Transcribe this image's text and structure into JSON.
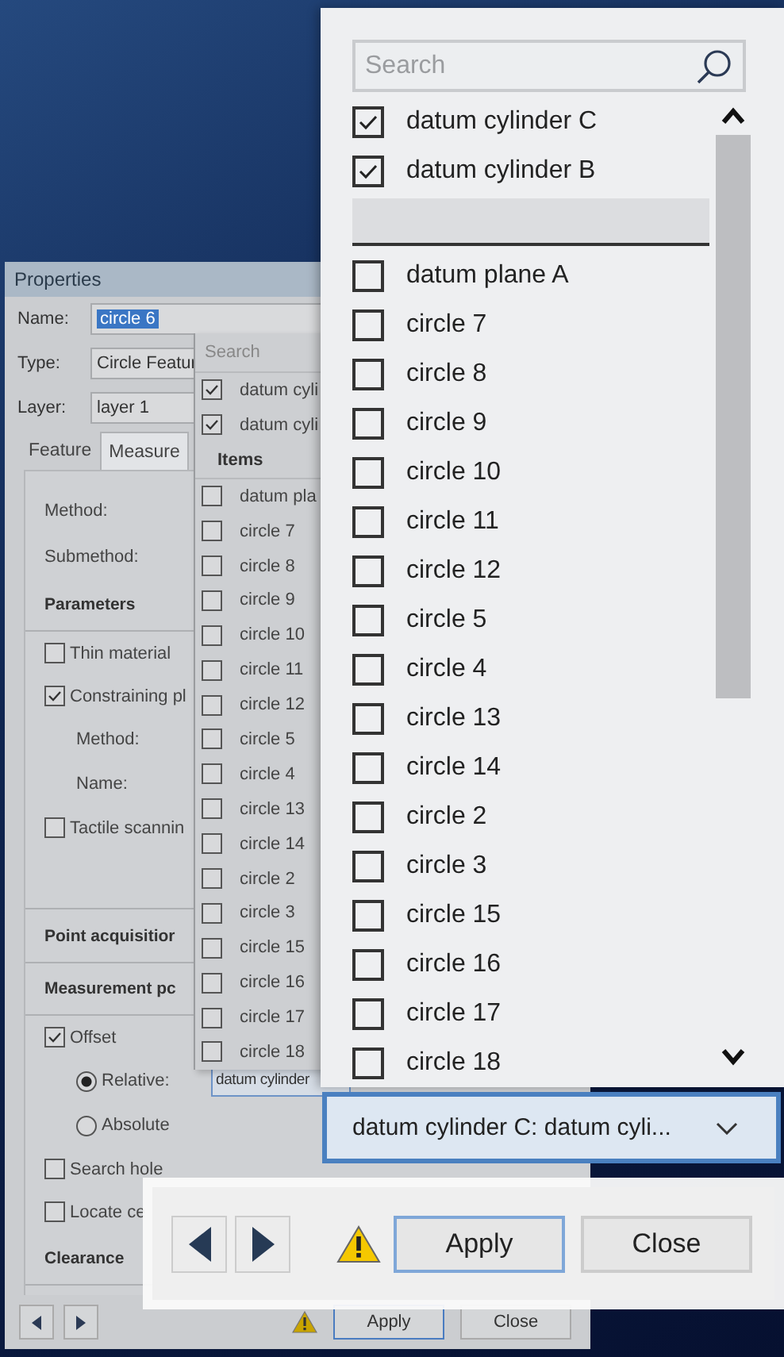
{
  "properties_window": {
    "title": "Properties",
    "fields": [
      {
        "label": "Name:",
        "value": "circle 6",
        "selected": true
      },
      {
        "label": "Type:",
        "value": "Circle Featur",
        "selected": false
      },
      {
        "label": "Layer:",
        "value": "layer 1",
        "selected": false
      }
    ],
    "tabs": [
      {
        "label": "Feature",
        "selected": false
      },
      {
        "label": "Measure",
        "selected": true
      }
    ],
    "rows": [
      {
        "kind": "label",
        "label": "Method:"
      },
      {
        "kind": "label",
        "label": "Submethod:"
      },
      {
        "kind": "heading",
        "label": "Parameters"
      },
      {
        "kind": "checkbox",
        "label": "Thin material",
        "checked": false
      },
      {
        "kind": "checkbox",
        "label": "Constraining pl",
        "checked": true
      },
      {
        "kind": "sublabel",
        "label": "Method:"
      },
      {
        "kind": "sublabel",
        "label": "Name:"
      },
      {
        "kind": "checkbox",
        "label": "Tactile scannin",
        "checked": false
      },
      {
        "kind": "section",
        "label": "Point acquisitior"
      },
      {
        "kind": "heading",
        "label": "Measurement pc"
      },
      {
        "kind": "checkbox",
        "label": "Offset",
        "checked": true
      },
      {
        "kind": "radio",
        "label": "Relative:",
        "selected": true,
        "value": "datum cylinder"
      },
      {
        "kind": "radio",
        "label": "Absolute",
        "selected": false
      },
      {
        "kind": "checkbox",
        "label": "Search hole",
        "checked": false
      },
      {
        "kind": "checkbox",
        "label": "Locate ce",
        "checked": false
      },
      {
        "kind": "heading",
        "label": "Clearance"
      }
    ],
    "dropdown": {
      "search_placeholder": "Search",
      "pinned": [
        {
          "label": "datum cyli",
          "checked": true
        },
        {
          "label": "datum cyli",
          "checked": true
        }
      ],
      "header": "Items",
      "items": [
        {
          "label": "datum pla",
          "checked": false
        },
        {
          "label": "circle 7",
          "checked": false
        },
        {
          "label": "circle 8",
          "checked": false
        },
        {
          "label": "circle 9",
          "checked": false
        },
        {
          "label": "circle 10",
          "checked": false
        },
        {
          "label": "circle 11",
          "checked": false
        },
        {
          "label": "circle 12",
          "checked": false
        },
        {
          "label": "circle 5",
          "checked": false
        },
        {
          "label": "circle 4",
          "checked": false
        },
        {
          "label": "circle 13",
          "checked": false
        },
        {
          "label": "circle 14",
          "checked": false
        },
        {
          "label": "circle 2",
          "checked": false
        },
        {
          "label": "circle 3",
          "checked": false
        },
        {
          "label": "circle 15",
          "checked": false
        },
        {
          "label": "circle 16",
          "checked": false
        },
        {
          "label": "circle 17",
          "checked": false
        },
        {
          "label": "circle 18",
          "checked": false
        }
      ]
    },
    "buttons": {
      "apply": "Apply",
      "close": "Close"
    }
  },
  "zoom_list": {
    "search_placeholder": "Search",
    "pinned": [
      {
        "label": "datum cylinder C",
        "checked": true
      },
      {
        "label": "datum cylinder B",
        "checked": true
      }
    ],
    "items": [
      {
        "label": "datum plane A",
        "checked": false
      },
      {
        "label": "circle 7",
        "checked": false
      },
      {
        "label": "circle 8",
        "checked": false
      },
      {
        "label": "circle 9",
        "checked": false
      },
      {
        "label": "circle 10",
        "checked": false
      },
      {
        "label": "circle 11",
        "checked": false
      },
      {
        "label": "circle 12",
        "checked": false
      },
      {
        "label": "circle 5",
        "checked": false
      },
      {
        "label": "circle 4",
        "checked": false
      },
      {
        "label": "circle 13",
        "checked": false
      },
      {
        "label": "circle 14",
        "checked": false
      },
      {
        "label": "circle 2",
        "checked": false
      },
      {
        "label": "circle 3",
        "checked": false
      },
      {
        "label": "circle 15",
        "checked": false
      },
      {
        "label": "circle 16",
        "checked": false
      },
      {
        "label": "circle 17",
        "checked": false
      },
      {
        "label": "circle 18",
        "checked": false
      }
    ],
    "combo_value": "datum cylinder C: datum cyli..."
  },
  "zoom_buttons": {
    "apply": "Apply",
    "close": "Close"
  }
}
